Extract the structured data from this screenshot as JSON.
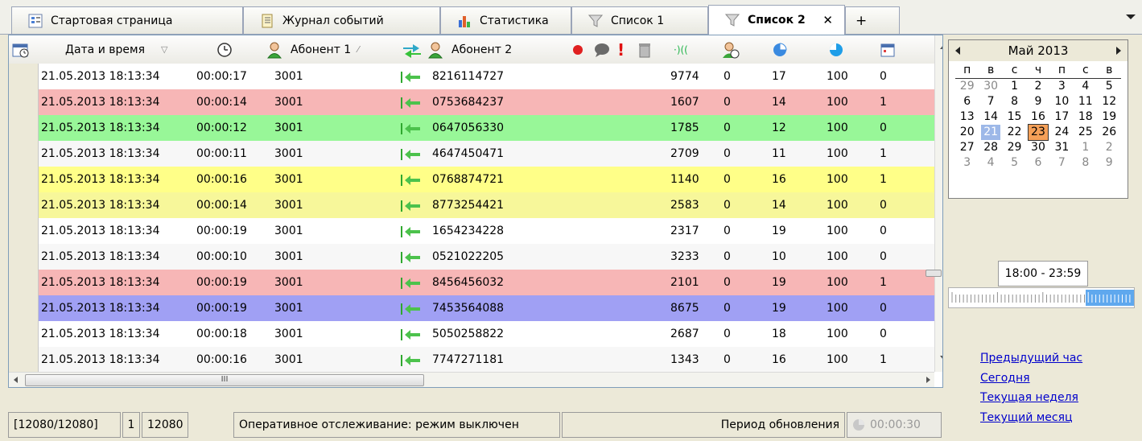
{
  "tabs": [
    {
      "label": "Стартовая страница",
      "icon": "home-list-icon"
    },
    {
      "label": "Журнал событий",
      "icon": "journal-icon"
    },
    {
      "label": "Статистика",
      "icon": "bar-chart-icon"
    },
    {
      "label": "Список 1",
      "icon": "filter-icon"
    },
    {
      "label": "Список 2",
      "icon": "filter-icon",
      "active": true
    }
  ],
  "tab_close": "✕",
  "tab_add": "+",
  "headers": {
    "datetime": "Дата и время",
    "subscriber1": "Абонент 1",
    "subscriber2": "Абонент 2"
  },
  "rows": [
    {
      "dt": "21.05.2013 18:13:34",
      "dur": "00:00:17",
      "a1": "3001",
      "a2": "8216114727",
      "n1": "9774",
      "n2": "0",
      "n3": "17",
      "n4": "100",
      "n5": "0",
      "bg": "#ffffff"
    },
    {
      "dt": "21.05.2013 18:13:34",
      "dur": "00:00:14",
      "a1": "3001",
      "a2": "0753684237",
      "n1": "1607",
      "n2": "0",
      "n3": "14",
      "n4": "100",
      "n5": "1",
      "bg": "#f7b6b6"
    },
    {
      "dt": "21.05.2013 18:13:34",
      "dur": "00:00:12",
      "a1": "3001",
      "a2": "0647056330",
      "n1": "1785",
      "n2": "0",
      "n3": "12",
      "n4": "100",
      "n5": "0",
      "bg": "#98f798"
    },
    {
      "dt": "21.05.2013 18:13:34",
      "dur": "00:00:11",
      "a1": "3001",
      "a2": "4647450471",
      "n1": "2709",
      "n2": "0",
      "n3": "11",
      "n4": "100",
      "n5": "1",
      "bg": "#f7f7f7"
    },
    {
      "dt": "21.05.2013 18:13:34",
      "dur": "00:00:16",
      "a1": "3001",
      "a2": "0768874721",
      "n1": "1140",
      "n2": "0",
      "n3": "16",
      "n4": "100",
      "n5": "1",
      "bg": "#ffff88"
    },
    {
      "dt": "21.05.2013 18:13:34",
      "dur": "00:00:14",
      "a1": "3001",
      "a2": "8773254421",
      "n1": "2583",
      "n2": "0",
      "n3": "14",
      "n4": "100",
      "n5": "0",
      "bg": "#f7f79a"
    },
    {
      "dt": "21.05.2013 18:13:34",
      "dur": "00:00:19",
      "a1": "3001",
      "a2": "1654234228",
      "n1": "2317",
      "n2": "0",
      "n3": "19",
      "n4": "100",
      "n5": "0",
      "bg": "#ffffff"
    },
    {
      "dt": "21.05.2013 18:13:34",
      "dur": "00:00:10",
      "a1": "3001",
      "a2": "0521022205",
      "n1": "3233",
      "n2": "0",
      "n3": "10",
      "n4": "100",
      "n5": "0",
      "bg": "#f7f7f7"
    },
    {
      "dt": "21.05.2013 18:13:34",
      "dur": "00:00:19",
      "a1": "3001",
      "a2": "8456456032",
      "n1": "2101",
      "n2": "0",
      "n3": "19",
      "n4": "100",
      "n5": "1",
      "bg": "#f7b6b6"
    },
    {
      "dt": "21.05.2013 18:13:34",
      "dur": "00:00:19",
      "a1": "3001",
      "a2": "7453564088",
      "n1": "8675",
      "n2": "0",
      "n3": "19",
      "n4": "100",
      "n5": "0",
      "bg": "#a0a0f4"
    },
    {
      "dt": "21.05.2013 18:13:34",
      "dur": "00:00:18",
      "a1": "3001",
      "a2": "5050258822",
      "n1": "2687",
      "n2": "0",
      "n3": "18",
      "n4": "100",
      "n5": "0",
      "bg": "#ffffff"
    },
    {
      "dt": "21.05.2013 18:13:34",
      "dur": "00:00:16",
      "a1": "3001",
      "a2": "7747271181",
      "n1": "1343",
      "n2": "0",
      "n3": "16",
      "n4": "100",
      "n5": "1",
      "bg": "#f7f7f7"
    }
  ],
  "hscroll_grip": "III",
  "status": {
    "count": "[12080/12080]",
    "page": "1",
    "total": "12080",
    "tracking": "Оперативное отслеживание: режим выключен",
    "refresh_label": "Период обновления",
    "refresh_value": "00:00:30"
  },
  "calendar": {
    "month": "Май 2013",
    "dows": [
      "п",
      "в",
      "с",
      "ч",
      "п",
      "с",
      "в"
    ],
    "weeks": [
      [
        {
          "d": "29",
          "o": 1
        },
        {
          "d": "30",
          "o": 1
        },
        {
          "d": "1"
        },
        {
          "d": "2"
        },
        {
          "d": "3"
        },
        {
          "d": "4"
        },
        {
          "d": "5"
        }
      ],
      [
        {
          "d": "6"
        },
        {
          "d": "7"
        },
        {
          "d": "8"
        },
        {
          "d": "9"
        },
        {
          "d": "10"
        },
        {
          "d": "11"
        },
        {
          "d": "12"
        }
      ],
      [
        {
          "d": "13"
        },
        {
          "d": "14"
        },
        {
          "d": "15"
        },
        {
          "d": "16"
        },
        {
          "d": "17"
        },
        {
          "d": "18"
        },
        {
          "d": "19"
        }
      ],
      [
        {
          "d": "20"
        },
        {
          "d": "21",
          "t": 1
        },
        {
          "d": "22"
        },
        {
          "d": "23",
          "m": 1
        },
        {
          "d": "24"
        },
        {
          "d": "25"
        },
        {
          "d": "26"
        }
      ],
      [
        {
          "d": "27"
        },
        {
          "d": "28"
        },
        {
          "d": "29"
        },
        {
          "d": "30"
        },
        {
          "d": "31"
        },
        {
          "d": "1",
          "o": 1
        },
        {
          "d": "2",
          "o": 1
        }
      ],
      [
        {
          "d": "3",
          "o": 1
        },
        {
          "d": "4",
          "o": 1
        },
        {
          "d": "5",
          "o": 1
        },
        {
          "d": "6",
          "o": 1
        },
        {
          "d": "7",
          "o": 1
        },
        {
          "d": "8",
          "o": 1
        },
        {
          "d": "9",
          "o": 1
        }
      ]
    ]
  },
  "time_range": "18:00 - 23:59",
  "links": [
    "Предыдущий час",
    "Сегодня",
    "Текущая неделя",
    "Текущий месяц"
  ],
  "colors": {
    "link": "#0000cc",
    "selected_day": "#9db8e8",
    "marked_day": "#f5a058",
    "slider_fill": "#5fa8ee"
  }
}
